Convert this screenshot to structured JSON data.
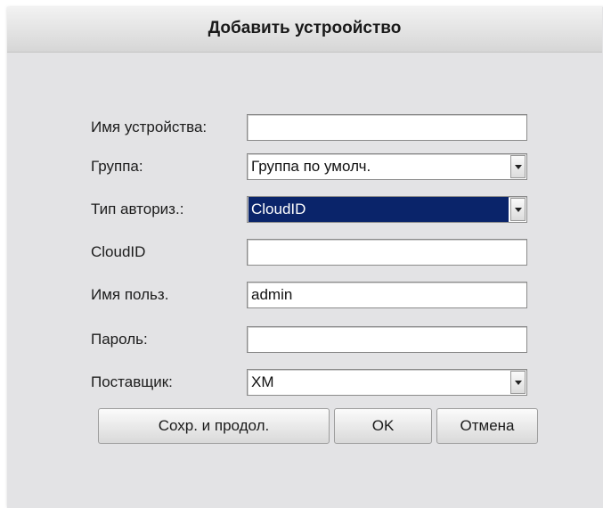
{
  "dialog": {
    "title": "Добавить устроойство"
  },
  "form": {
    "device_name": {
      "label": "Имя устройства:",
      "value": ""
    },
    "group": {
      "label": "Группа:",
      "value": "Группа по умолч."
    },
    "auth_type": {
      "label": "Тип авториз.:",
      "value": "CloudID"
    },
    "cloud_id": {
      "label": "CloudID",
      "value": ""
    },
    "username": {
      "label": "Имя польз.",
      "value": "admin"
    },
    "password": {
      "label": "Пароль:",
      "value": ""
    },
    "vendor": {
      "label": "Поставщик:",
      "value": "XM"
    }
  },
  "buttons": {
    "save_continue": "Сохр. и продол.",
    "ok": "OK",
    "cancel": "Отмена"
  },
  "icons": {
    "dropdown": "chevron-down-icon"
  },
  "colors": {
    "dialog_background": "#e3e3e5",
    "selection_highlight": "#0a246a"
  }
}
